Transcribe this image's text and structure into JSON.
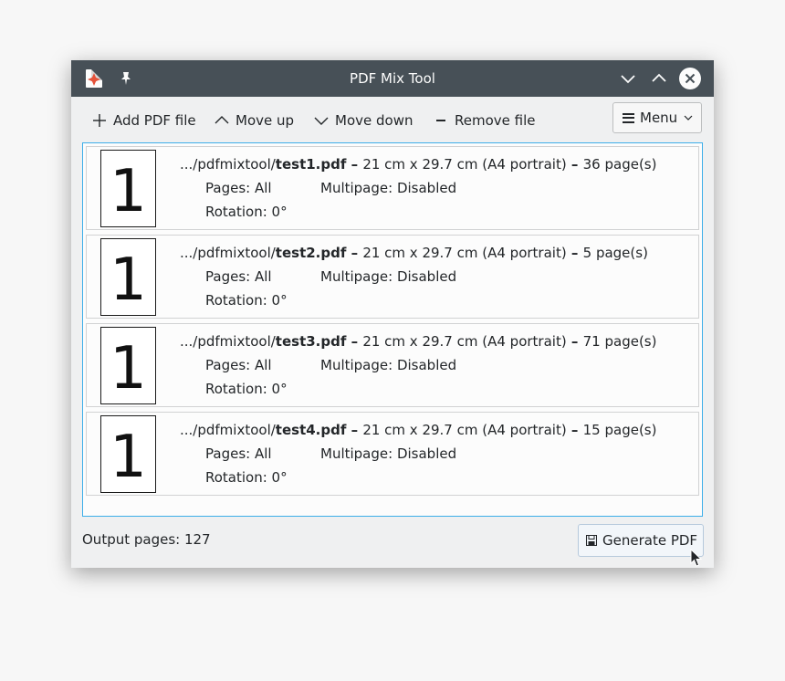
{
  "window": {
    "title": "PDF Mix Tool"
  },
  "toolbar": {
    "add_label": "Add PDF file",
    "up_label": "Move up",
    "down_label": "Move down",
    "remove_label": "Remove file",
    "menu_label": "Menu"
  },
  "files": [
    {
      "thumb": "1",
      "dir": ".../pdfmixtool/",
      "name": "test1.pdf",
      "sep1": " – ",
      "size": "21 cm x 29.7 cm (A4 portrait)",
      "sep2": " – ",
      "pages": "36 page(s)",
      "pages_label": "Pages: All",
      "multipage_label": "Multipage: Disabled",
      "rotation_label": "Rotation: 0°"
    },
    {
      "thumb": "1",
      "dir": ".../pdfmixtool/",
      "name": "test2.pdf",
      "sep1": " – ",
      "size": "21 cm x 29.7 cm (A4 portrait)",
      "sep2": " – ",
      "pages": "5 page(s)",
      "pages_label": "Pages: All",
      "multipage_label": "Multipage: Disabled",
      "rotation_label": "Rotation: 0°"
    },
    {
      "thumb": "1",
      "dir": ".../pdfmixtool/",
      "name": "test3.pdf",
      "sep1": " – ",
      "size": "21 cm x 29.7 cm (A4 portrait)",
      "sep2": " – ",
      "pages": "71 page(s)",
      "pages_label": "Pages: All",
      "multipage_label": "Multipage: Disabled",
      "rotation_label": "Rotation: 0°"
    },
    {
      "thumb": "1",
      "dir": ".../pdfmixtool/",
      "name": "test4.pdf",
      "sep1": " – ",
      "size": "21 cm x 29.7 cm (A4 portrait)",
      "sep2": " – ",
      "pages": "15 page(s)",
      "pages_label": "Pages: All",
      "multipage_label": "Multipage: Disabled",
      "rotation_label": "Rotation: 0°"
    }
  ],
  "footer": {
    "output_pages": "Output pages: 127",
    "generate_label": "Generate PDF"
  },
  "colors": {
    "titlebar": "#475057",
    "selection_border": "#3daee9",
    "window_bg": "#eff0f1"
  },
  "icons": {
    "app": "pdf-mix-tool-app-icon",
    "pin": "pin-icon",
    "add": "plus-icon",
    "up": "chevron-up-icon",
    "down": "chevron-down-icon",
    "remove": "minus-icon",
    "menu": "hamburger-icon",
    "save": "save-icon"
  }
}
